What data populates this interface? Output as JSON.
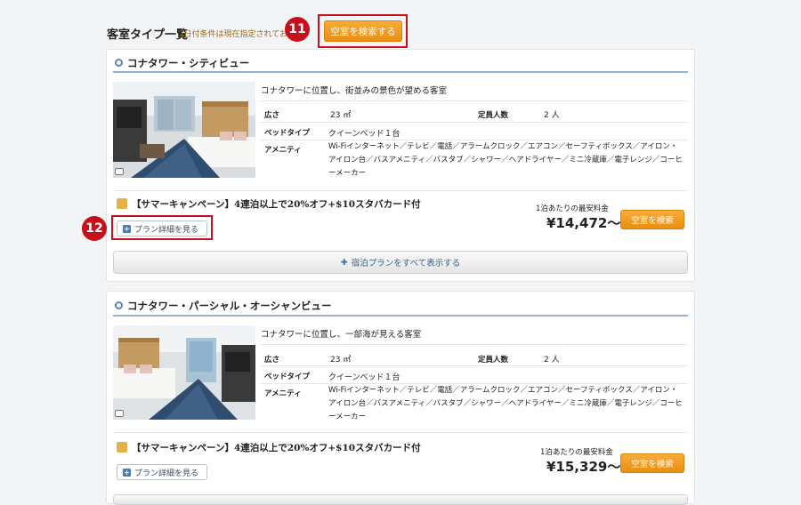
{
  "header": {
    "title": "客室タイプ一覧",
    "note": "(日付条件は現在指定されておりません)",
    "search_button": "空室を検索する",
    "callout_11": "11"
  },
  "rooms": [
    {
      "name": "コナタワー・シティビュー",
      "description": "コナタワーに位置し、街並みの景色が望める客室",
      "size_label": "広さ",
      "size_value": "23 ㎡",
      "capacity_label": "定員人数",
      "capacity_value": "2 人",
      "bed_label": "ベッドタイプ",
      "bed_value": "クイーンベッド１台",
      "amenity_label": "アメニティ",
      "amenity_value": "Wi-Fiインターネット／テレビ／電話／アラームクロック／エアコン／セーフティボックス／アイロン・アイロン台／バスアメニティ／バスタブ／シャワー／ヘアドライヤー／ミニ冷蔵庫／電子レンジ／コーヒーメーカー",
      "plan_title": "【サマーキャンペーン】4連泊以上で20%オフ+$10スタバカード付",
      "plan_detail_button": "プラン詳細を見る",
      "price_note": "1泊あたりの最安料金",
      "price": "¥14,472〜",
      "search_button": "空室を検索",
      "show_all_button": "宿泊プランをすべて表示する"
    },
    {
      "name": "コナタワー・パーシャル・オーシャンビュー",
      "description": "コナタワーに位置し、一部海が見える客室",
      "size_label": "広さ",
      "size_value": "23 ㎡",
      "capacity_label": "定員人数",
      "capacity_value": "2 人",
      "bed_label": "ベッドタイプ",
      "bed_value": "クイーンベッド１台",
      "amenity_label": "アメニティ",
      "amenity_value": "Wi-Fiインターネット／テレビ／電話／アラームクロック／エアコン／セーフティボックス／アイロン・アイロン台／バスアメニティ／バスタブ／シャワー／ヘアドライヤー／ミニ冷蔵庫／電子レンジ／コーヒーメーカー",
      "plan_title": "【サマーキャンペーン】4連泊以上で20%オフ+$10スタバカード付",
      "plan_detail_button": "プラン詳細を見る",
      "price_note": "1泊あたりの最安料金",
      "price": "¥15,329〜",
      "search_button": "空室を検索"
    }
  ],
  "callout_12": "12"
}
